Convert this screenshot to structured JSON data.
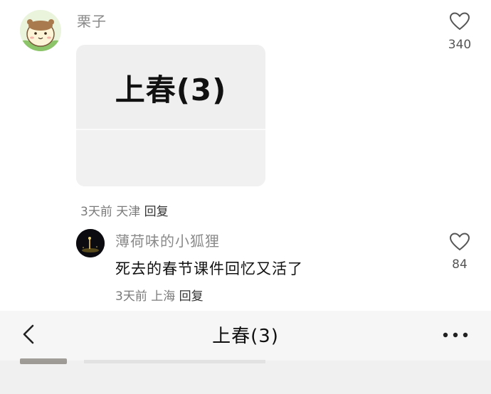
{
  "comment": {
    "author": "栗子",
    "image_title": "上春(3)",
    "time": "3天前",
    "location": "天津",
    "reply_label": "回复",
    "likes": "340"
  },
  "reply": {
    "author": "薄荷味的小狐狸",
    "text": "死去的春节课件回忆又活了",
    "time": "3天前",
    "location": "上海",
    "reply_label": "回复",
    "likes": "84"
  },
  "header": {
    "title": "上春(3)"
  },
  "icons": {
    "like": "heart-icon",
    "back": "chevron-left-icon",
    "more": "more-dots-icon"
  }
}
